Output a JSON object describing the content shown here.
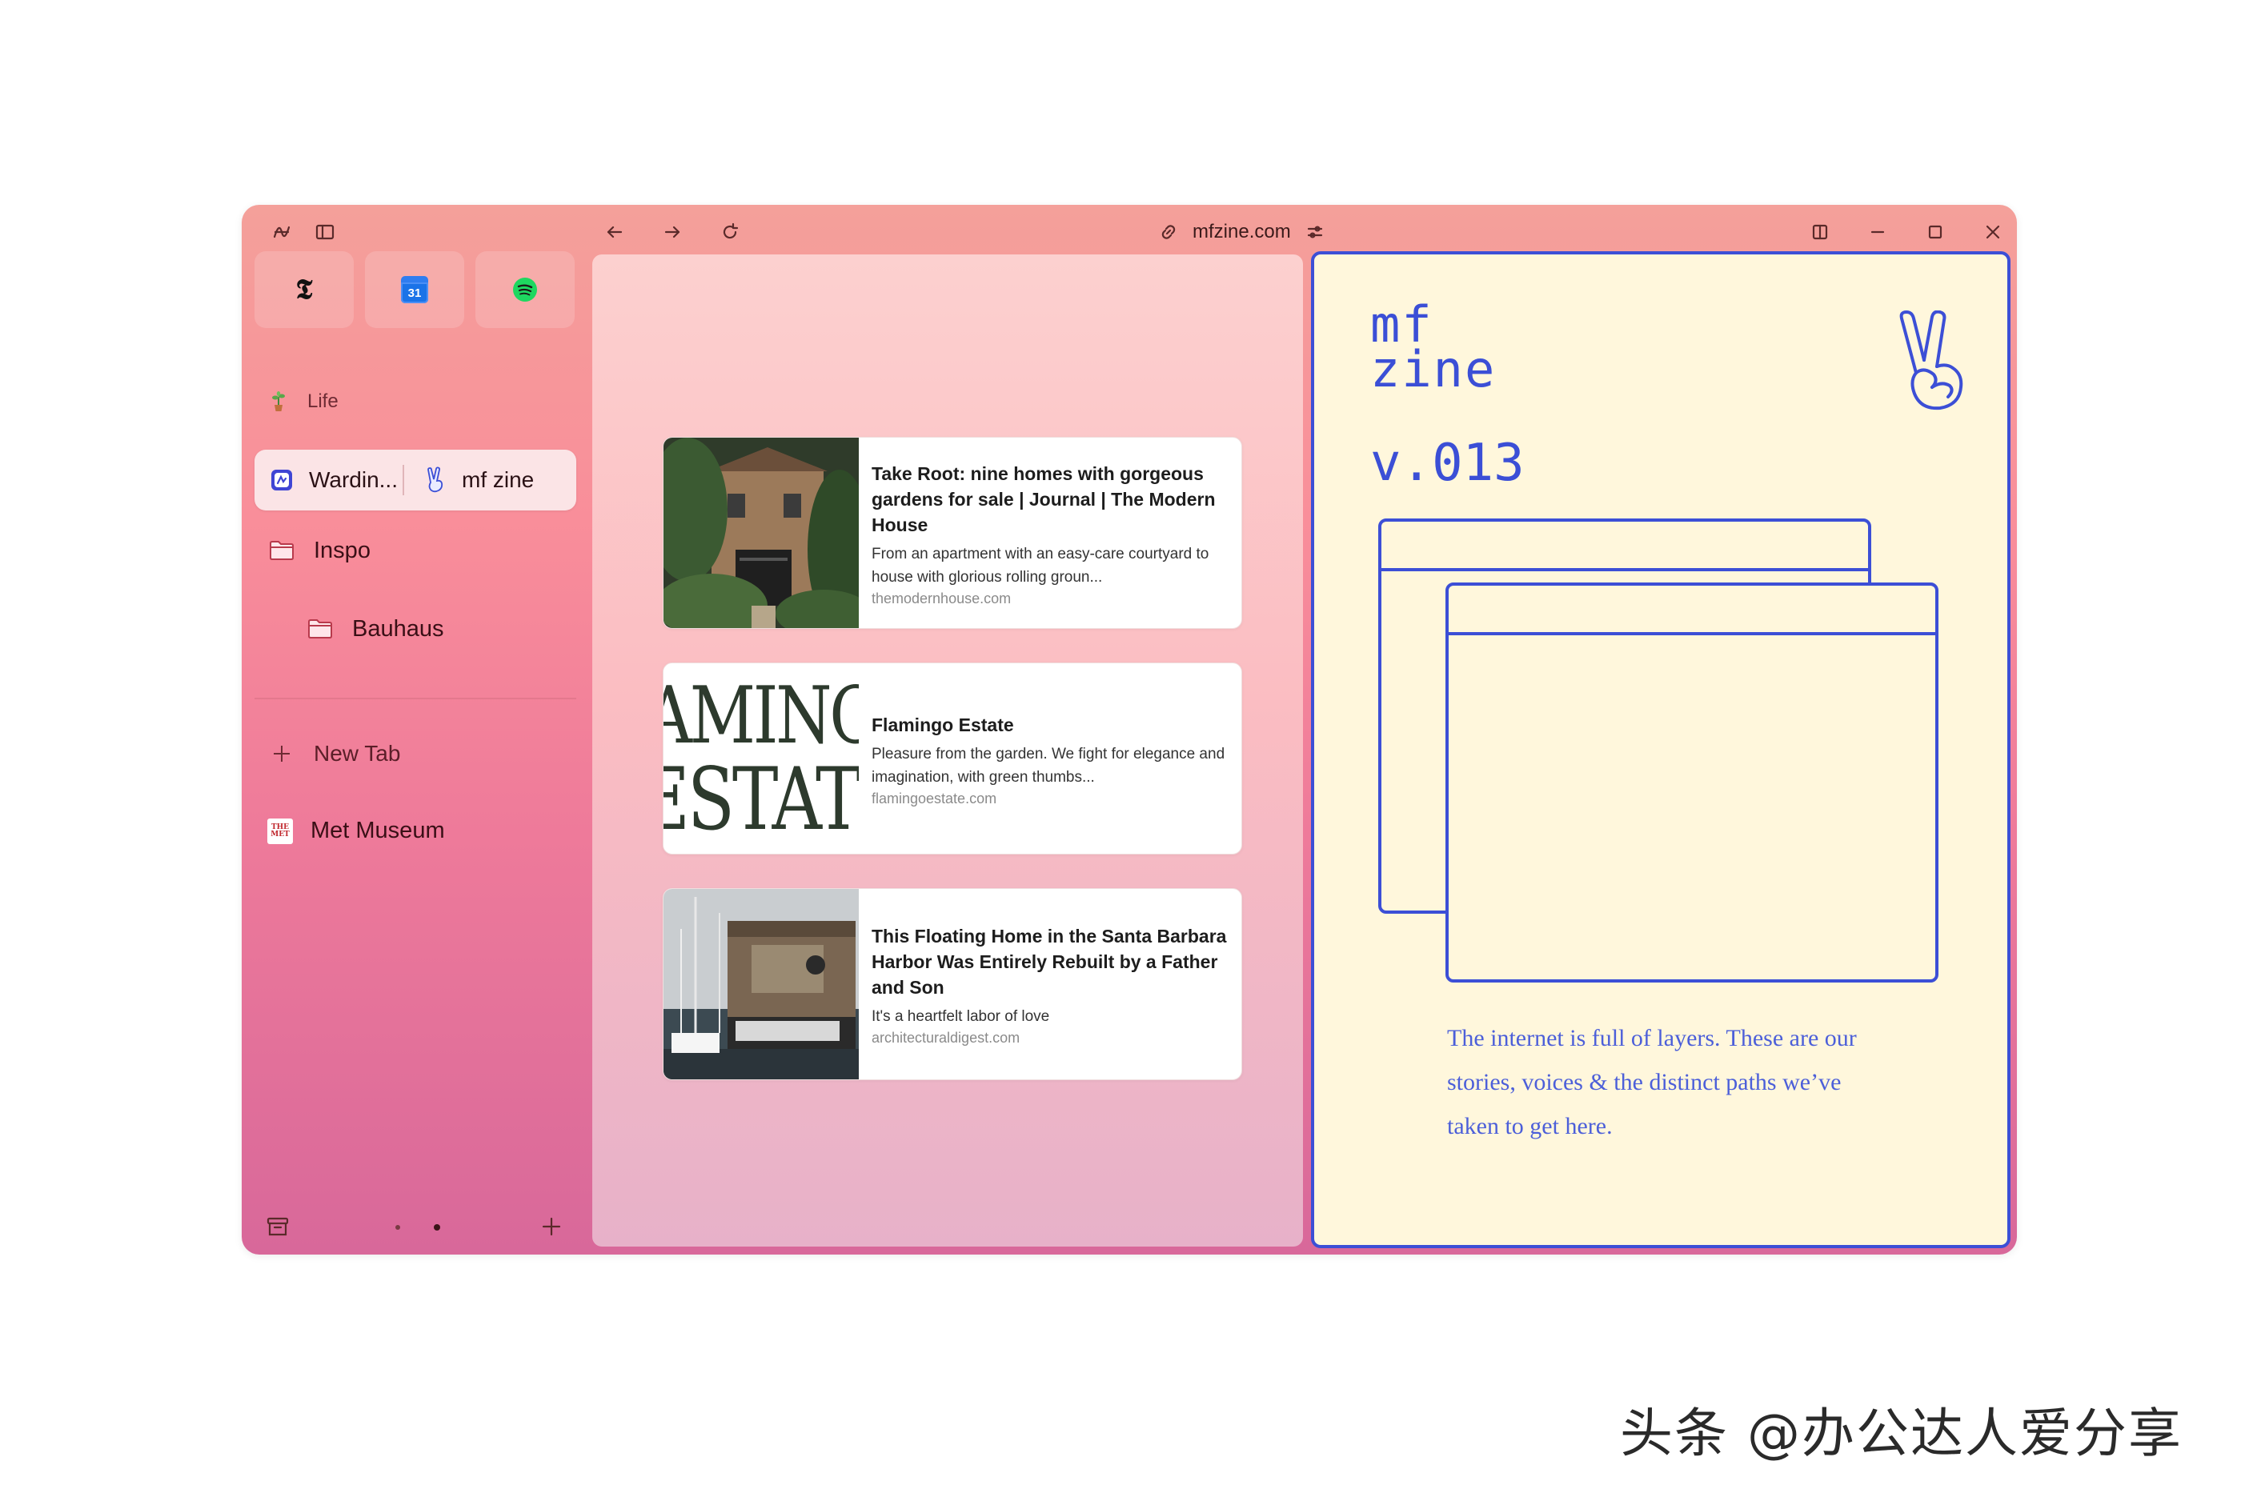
{
  "browser": {
    "url": "mfzine.com"
  },
  "sidebar": {
    "pinned": [
      {
        "name": "nytimes-icon",
        "glyph": "𝕿"
      },
      {
        "name": "google-calendar-icon",
        "glyph": "31"
      },
      {
        "name": "spotify-icon",
        "glyph": ""
      }
    ],
    "space_label": "Life",
    "split_tab": {
      "left_label": "Wardin...",
      "right_label": "mf zine"
    },
    "folders": [
      {
        "label": "Inspo"
      },
      {
        "label": "Bauhaus"
      }
    ],
    "new_tab_label": "New Tab",
    "tabs": [
      {
        "label": "Met Museum",
        "favicon_text": "THE MET"
      }
    ]
  },
  "cards": [
    {
      "title": "Take Root: nine homes with gorgeous gardens for sale | Journal | The Modern House",
      "description": "From an apartment with an easy-care courtyard to house with glorious rolling groun...",
      "domain": "themodernhouse.com"
    },
    {
      "title": "Flamingo Estate",
      "description": "Pleasure from the garden. We fight for elegance and imagination, with green thumbs...",
      "domain": "flamingoestate.com",
      "thumb_text_1": "AMINC",
      "thumb_text_2": "ESTATI"
    },
    {
      "title": "This Floating Home in the Santa Barbara Harbor Was Entirely Rebuilt by a Father and Son",
      "description": "It's a heartfelt labor of love",
      "domain": "architecturaldigest.com"
    }
  ],
  "zine": {
    "logo_line1": "mf",
    "logo_line2": "zine",
    "version": "v.013",
    "body": "The internet is full of layers. These are our stories, voices & the distinct paths we’ve taken to get here."
  },
  "watermark": "头条 @办公达人爱分享",
  "colors": {
    "accent": "#3c4fd6",
    "zine_bg": "#fff7dc"
  }
}
